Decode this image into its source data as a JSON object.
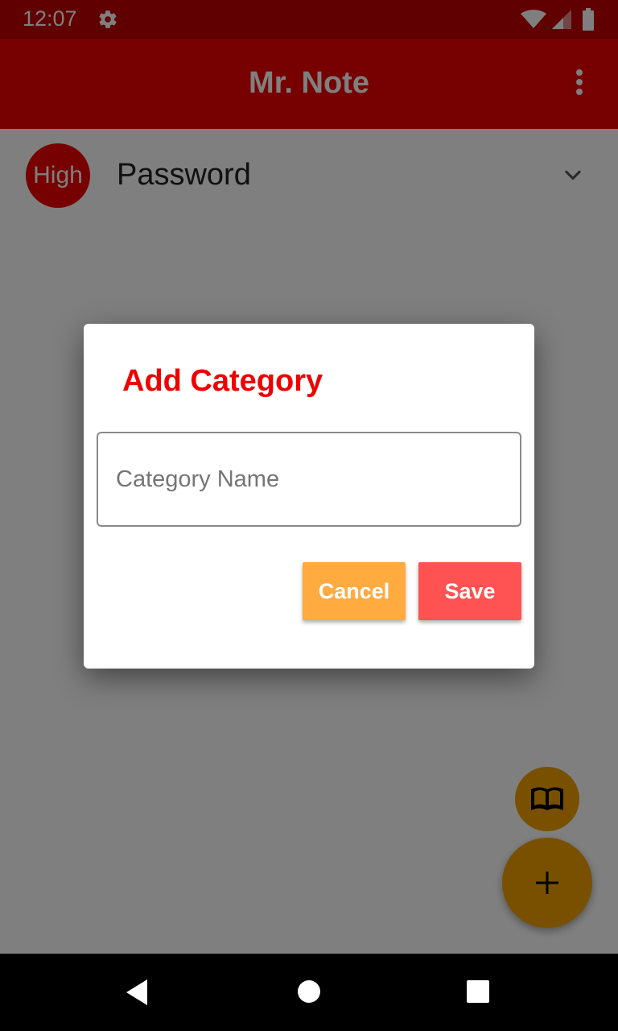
{
  "status_bar": {
    "time": "12:07",
    "icons": [
      "gear-icon",
      "wifi-icon",
      "signal-icon",
      "battery-icon"
    ]
  },
  "app_bar": {
    "title": "Mr. Note",
    "menu_icon": "more-vert-icon"
  },
  "list": {
    "items": [
      {
        "priority": "High",
        "title": "Password",
        "expand_icon": "chevron-down-icon"
      }
    ]
  },
  "dialog": {
    "title": "Add Category",
    "input": {
      "placeholder": "Category Name",
      "value": ""
    },
    "cancel_label": "Cancel",
    "save_label": "Save"
  },
  "fabs": {
    "secondary_icon": "book-open-icon",
    "primary_icon": "plus-icon"
  },
  "nav_bar": {
    "icons": [
      "back-icon",
      "home-icon",
      "recents-icon"
    ]
  },
  "colors": {
    "primary": "#ee0000",
    "status_bar": "#c00000",
    "accent": "#f0a000",
    "cancel_button": "#ffab40",
    "save_button": "#ff5252",
    "scrim": "rgba(0,0,0,0.5)"
  }
}
